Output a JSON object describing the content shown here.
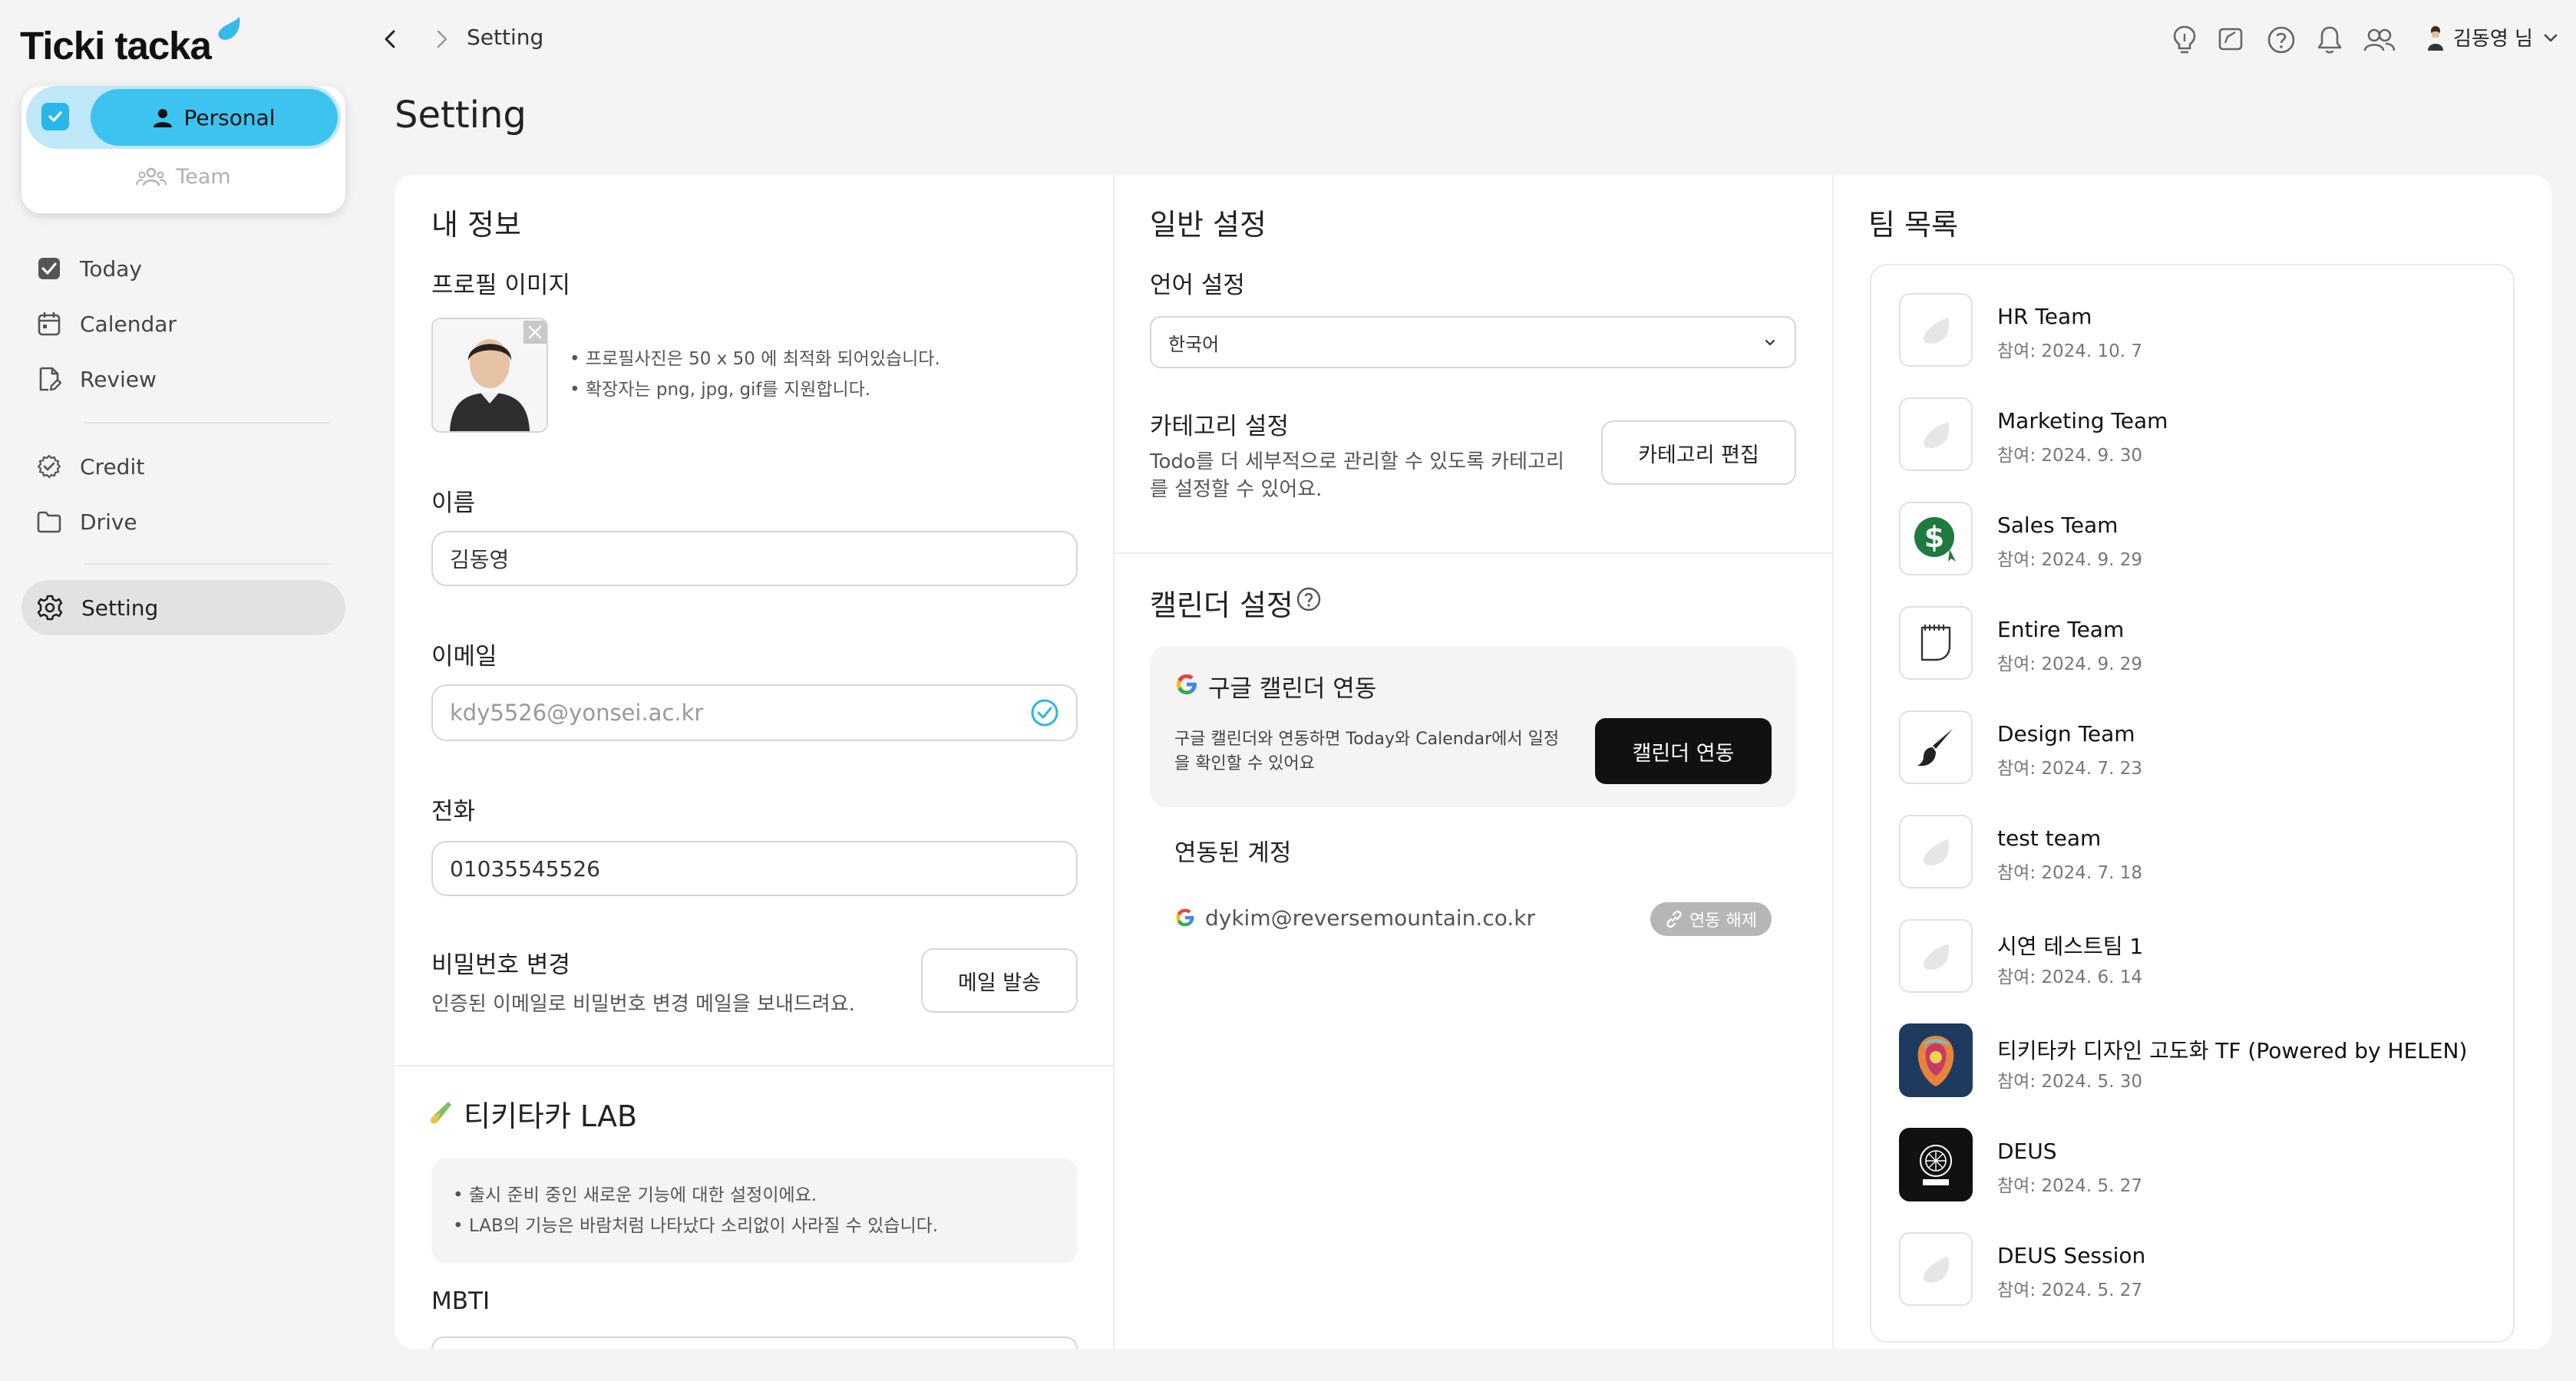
{
  "app": {
    "logo": "Ticki tacka"
  },
  "workspace": {
    "personal_label": "Personal",
    "team_label": "Team"
  },
  "sidebar": {
    "items": [
      {
        "label": "Today",
        "icon": "checkbox-icon"
      },
      {
        "label": "Calendar",
        "icon": "calendar-icon"
      },
      {
        "label": "Review",
        "icon": "review-icon"
      },
      {
        "label": "Credit",
        "icon": "credit-icon"
      },
      {
        "label": "Drive",
        "icon": "folder-icon"
      },
      {
        "label": "Setting",
        "icon": "gear-icon"
      }
    ]
  },
  "topbar": {
    "breadcrumb": "Setting",
    "user_name": "김동영 님"
  },
  "page": {
    "title": "Setting"
  },
  "profile": {
    "section_title": "내 정보",
    "image_label": "프로필 이미지",
    "image_notes": [
      "프로필사진은 50 x 50 에 최적화 되어있습니다.",
      "확장자는 png, jpg, gif를 지원합니다."
    ],
    "name_label": "이름",
    "name_value": "김동영",
    "email_label": "이메일",
    "email_value": "kdy5526@yonsei.ac.kr",
    "phone_label": "전화",
    "phone_value": "01035545526",
    "password_label": "비밀번호 변경",
    "password_desc": "인증된 이메일로 비밀번호 변경 메일을 보내드려요.",
    "password_button": "메일 발송"
  },
  "lab": {
    "title": "티키타카 LAB",
    "notes": [
      "출시 준비 중인 새로운 기능에 대한 설정이에요.",
      "LAB의 기능은 바람처럼 나타났다 소리없이 사라질 수 있습니다."
    ],
    "mbti_label": "MBTI"
  },
  "general": {
    "section_title": "일반 설정",
    "language_label": "언어 설정",
    "language_value": "한국어",
    "category_label": "카테고리 설정",
    "category_desc_1": "Todo를 더 세부적으로 관리할 수 있도록 카테고리",
    "category_desc_2": "를 설정할 수 있어요.",
    "category_button": "카테고리 편집"
  },
  "calendar": {
    "section_title": "캘린더 설정",
    "google_title": "구글 캘린더 연동",
    "google_desc_1": "구글 캘린더와 연동하면 Today와 Calendar에서 일정",
    "google_desc_2": "을 확인할 수 있어요",
    "connect_button": "캘린더 연동",
    "linked_label": "연동된 계정",
    "linked_email": "dykim@reversemountain.co.kr",
    "unlink_button": "연동 해제"
  },
  "teams": {
    "section_title": "팀 목록",
    "items": [
      {
        "name": "HR Team",
        "date": "참여: 2024. 10. 7"
      },
      {
        "name": "Marketing Team",
        "date": "참여: 2024. 9. 30"
      },
      {
        "name": "Sales Team",
        "date": "참여: 2024. 9. 29"
      },
      {
        "name": "Entire Team",
        "date": "참여: 2024. 9. 29"
      },
      {
        "name": "Design Team",
        "date": "참여: 2024. 7. 23"
      },
      {
        "name": "test team",
        "date": "참여: 2024. 7. 18"
      },
      {
        "name": "시연 테스트팀 1",
        "date": "참여: 2024. 6. 14"
      },
      {
        "name": "티키타카 디자인 고도화 TF (Powered by HELEN)",
        "date": "참여: 2024. 5. 30"
      },
      {
        "name": "DEUS",
        "date": "참여: 2024. 5. 27"
      },
      {
        "name": "DEUS Session",
        "date": "참여: 2024. 5. 27"
      }
    ]
  },
  "colors": {
    "accent": "#3cc3f0",
    "accent_light": "#bfe8f8",
    "dark_button": "#111111",
    "page_bg": "#f4f4f5"
  }
}
